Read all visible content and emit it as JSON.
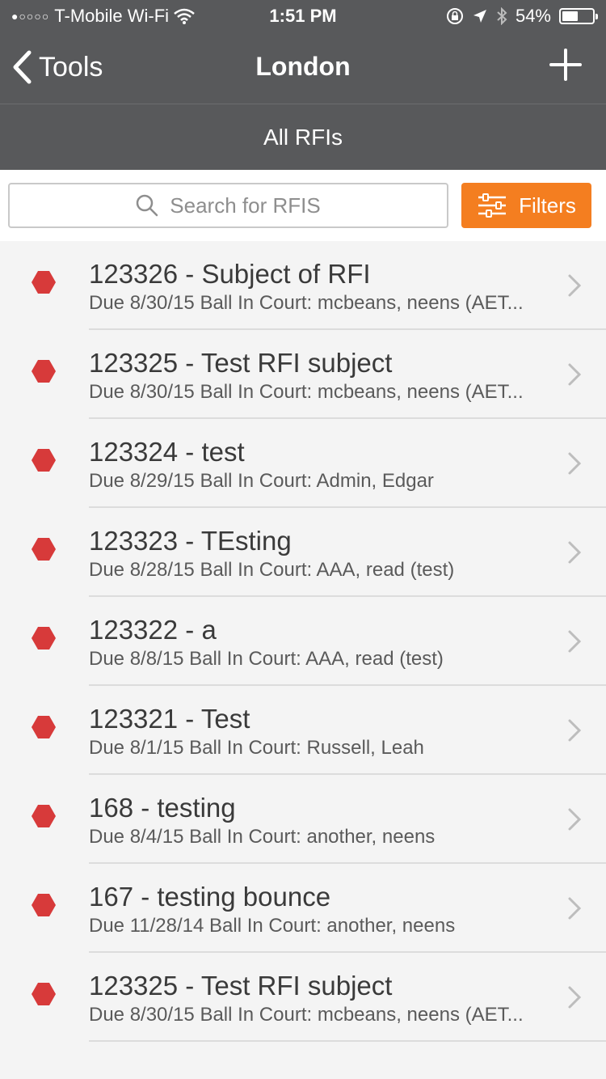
{
  "status_bar": {
    "carrier": "T-Mobile Wi-Fi",
    "time": "1:51 PM",
    "battery": "54%",
    "battery_level": 0.54
  },
  "nav": {
    "back_label": "Tools",
    "title": "London"
  },
  "subheader": {
    "title": "All RFIs"
  },
  "search": {
    "placeholder": "Search for RFIS"
  },
  "filters": {
    "label": "Filters"
  },
  "colors": {
    "accent": "#f47e20",
    "status_red": "#d73a3a",
    "header_bg": "#58595b"
  },
  "rfis": [
    {
      "title": "123326 - Subject of RFI",
      "subtitle": "Due 8/30/15  Ball In Court: mcbeans, neens (AET..."
    },
    {
      "title": "123325 - Test RFI subject",
      "subtitle": "Due 8/30/15  Ball In Court: mcbeans, neens (AET..."
    },
    {
      "title": "123324 - test",
      "subtitle": "Due 8/29/15  Ball In Court: Admin, Edgar"
    },
    {
      "title": "123323 - TEsting",
      "subtitle": "Due 8/28/15  Ball In Court: AAA, read (test)"
    },
    {
      "title": "123322 - a",
      "subtitle": "Due 8/8/15  Ball In Court: AAA, read (test)"
    },
    {
      "title": "123321 - Test",
      "subtitle": "Due 8/1/15  Ball In Court: Russell, Leah"
    },
    {
      "title": "168 - testing",
      "subtitle": "Due 8/4/15  Ball In Court: another, neens"
    },
    {
      "title": "167 - testing bounce",
      "subtitle": "Due 11/28/14  Ball In Court: another, neens"
    },
    {
      "title": "123325 - Test RFI subject",
      "subtitle": "Due 8/30/15  Ball In Court: mcbeans, neens (AET..."
    }
  ]
}
